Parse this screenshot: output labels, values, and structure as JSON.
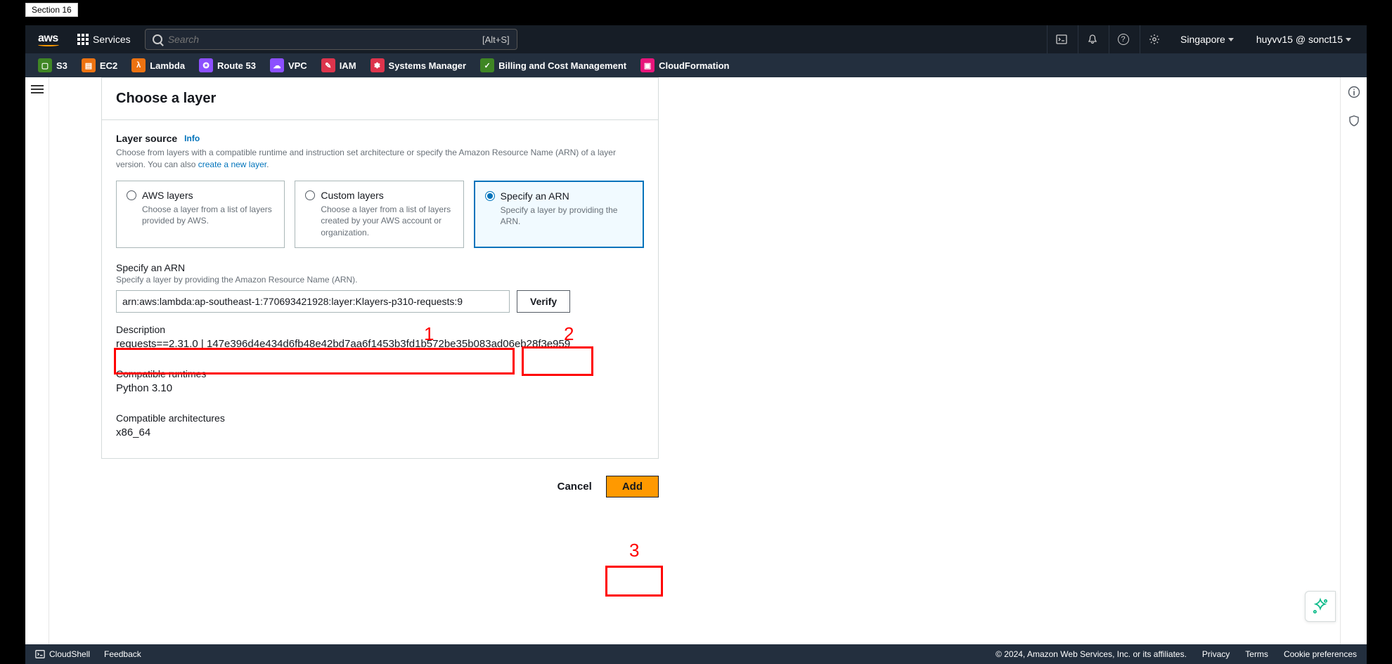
{
  "section_tag": "Section 16",
  "nav1": {
    "logo": "aws",
    "services_label": "Services",
    "search_placeholder": "Search",
    "search_shortcut": "[Alt+S]",
    "region": "Singapore",
    "account": "huyvv15 @ sonct15"
  },
  "nav2": {
    "items": [
      {
        "label": "S3",
        "color": "#3f8624"
      },
      {
        "label": "EC2",
        "color": "#ec7211"
      },
      {
        "label": "Lambda",
        "color": "#ec7211"
      },
      {
        "label": "Route 53",
        "color": "#8c4fff"
      },
      {
        "label": "VPC",
        "color": "#8c4fff"
      },
      {
        "label": "IAM",
        "color": "#dd344c"
      },
      {
        "label": "Systems Manager",
        "color": "#dd344c"
      },
      {
        "label": "Billing and Cost Management",
        "color": "#3f8624"
      },
      {
        "label": "CloudFormation",
        "color": "#e7157b"
      }
    ]
  },
  "panel": {
    "title": "Choose a layer",
    "layer_source_label": "Layer source",
    "info": "Info",
    "layer_source_help_1": "Choose from layers with a compatible runtime and instruction set architecture or specify the Amazon Resource Name (ARN) of a layer version. You can also ",
    "layer_source_help_link": "create a new layer",
    "layer_source_help_2": ".",
    "options": [
      {
        "title": "AWS layers",
        "desc": "Choose a layer from a list of layers provided by AWS."
      },
      {
        "title": "Custom layers",
        "desc": "Choose a layer from a list of layers created by your AWS account or organization."
      },
      {
        "title": "Specify an ARN",
        "desc": "Specify a layer by providing the ARN."
      }
    ],
    "selected_option": 2,
    "arn_label": "Specify an ARN",
    "arn_help": "Specify a layer by providing the Amazon Resource Name (ARN).",
    "arn_value": "arn:aws:lambda:ap-southeast-1:770693421928:layer:Klayers-p310-requests:9",
    "verify_label": "Verify",
    "description_label": "Description",
    "description_value": "requests==2.31.0 | 147e396d4e434d6fb48e42bd7aa6f1453b3fd1b572be35b083ad06eb28f3e959",
    "runtimes_label": "Compatible runtimes",
    "runtimes_value": "Python 3.10",
    "arch_label": "Compatible architectures",
    "arch_value": "x86_64"
  },
  "actions": {
    "cancel": "Cancel",
    "add": "Add"
  },
  "footer": {
    "cloudshell": "CloudShell",
    "feedback": "Feedback",
    "copyright": "© 2024, Amazon Web Services, Inc. or its affiliates.",
    "privacy": "Privacy",
    "terms": "Terms",
    "cookie": "Cookie preferences"
  },
  "annotations": {
    "n1": "1",
    "n2": "2",
    "n3": "3"
  }
}
